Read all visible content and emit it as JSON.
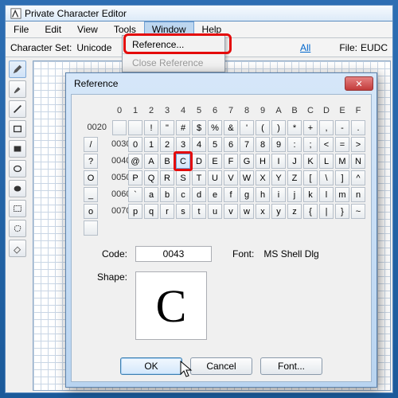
{
  "window": {
    "title": "Private Character Editor"
  },
  "menubar": {
    "items": [
      "File",
      "Edit",
      "View",
      "Tools",
      "Window",
      "Help"
    ],
    "open_index": 4
  },
  "optionbar": {
    "charset_label": "Character Set:",
    "charset_value": "Unicode",
    "code_link": "All",
    "file_label": "File:",
    "file_value": "EUDC"
  },
  "window_menu": {
    "items": [
      {
        "label": "Reference...",
        "enabled": true
      },
      {
        "label": "Close Reference",
        "enabled": false
      }
    ]
  },
  "tools": [
    "pencil",
    "brush",
    "line",
    "rect-outline",
    "rect-fill",
    "ellipse-outline",
    "ellipse-fill",
    "select-rect",
    "select-free",
    "eraser"
  ],
  "dialog": {
    "title": "Reference",
    "close": "✕",
    "cols": [
      "0",
      "1",
      "2",
      "3",
      "4",
      "5",
      "6",
      "7",
      "8",
      "9",
      "A",
      "B",
      "C",
      "D",
      "E",
      "F"
    ],
    "rows": [
      {
        "label": "0020",
        "chars": [
          "",
          " ",
          "!",
          "\"",
          "#",
          "$",
          "%",
          "&",
          "'",
          "(",
          ")",
          "*",
          "+",
          ",",
          "-",
          ".",
          "/"
        ]
      },
      {
        "label": "0030",
        "chars": [
          "0",
          "1",
          "2",
          "3",
          "4",
          "5",
          "6",
          "7",
          "8",
          "9",
          ":",
          ";",
          "<",
          "=",
          ">",
          "?"
        ]
      },
      {
        "label": "0040",
        "chars": [
          "@",
          "A",
          "B",
          "C",
          "D",
          "E",
          "F",
          "G",
          "H",
          "I",
          "J",
          "K",
          "L",
          "M",
          "N",
          "O"
        ]
      },
      {
        "label": "0050",
        "chars": [
          "P",
          "Q",
          "R",
          "S",
          "T",
          "U",
          "V",
          "W",
          "X",
          "Y",
          "Z",
          "[",
          "\\",
          "]",
          "^",
          "_"
        ]
      },
      {
        "label": "0060",
        "chars": [
          "`",
          "a",
          "b",
          "c",
          "d",
          "e",
          "f",
          "g",
          "h",
          "i",
          "j",
          "k",
          "l",
          "m",
          "n",
          "o"
        ]
      },
      {
        "label": "0070",
        "chars": [
          "p",
          "q",
          "r",
          "s",
          "t",
          "u",
          "v",
          "w",
          "x",
          "y",
          "z",
          "{",
          "|",
          "}",
          "~",
          ""
        ]
      }
    ],
    "selected": {
      "row": 2,
      "col": 3
    },
    "code_label": "Code:",
    "code_value": "0043",
    "font_label": "Font:",
    "font_value": "MS Shell Dlg",
    "shape_label": "Shape:",
    "shape_value": "C",
    "buttons": {
      "ok": "OK",
      "cancel": "Cancel",
      "font": "Font..."
    }
  }
}
